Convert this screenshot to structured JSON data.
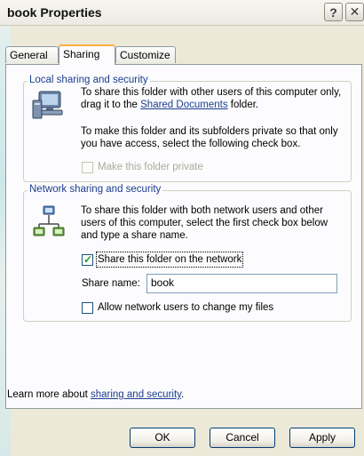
{
  "window": {
    "title": "book Properties",
    "help_label": "?",
    "close_label": "✕"
  },
  "tabs": [
    {
      "label": "General"
    },
    {
      "label": "Sharing"
    },
    {
      "label": "Customize"
    }
  ],
  "local_section": {
    "legend": "Local sharing and security",
    "text1_pre": "To share this folder with other users of this computer only, drag it to the ",
    "text1_link": "Shared Documents",
    "text1_post": " folder.",
    "text2": "To make this folder and its subfolders private so that only you have access, select the following check box.",
    "private_checkbox_label": "Make this folder private",
    "private_checked": false
  },
  "network_section": {
    "legend": "Network sharing and security",
    "text": "To share this folder with both network users and other users of this computer, select the first check box below and type a share name.",
    "share_checkbox_label": "Share this folder on the network",
    "share_checked": true,
    "share_name_label": "Share name:",
    "share_name_value": "book",
    "allow_change_label": "Allow network users to change my files",
    "allow_change_checked": false
  },
  "footer": {
    "learn_pre": "Learn more about ",
    "learn_link": "sharing and security",
    "learn_post": "."
  },
  "buttons": {
    "ok": "OK",
    "cancel": "Cancel",
    "apply": "Apply"
  }
}
